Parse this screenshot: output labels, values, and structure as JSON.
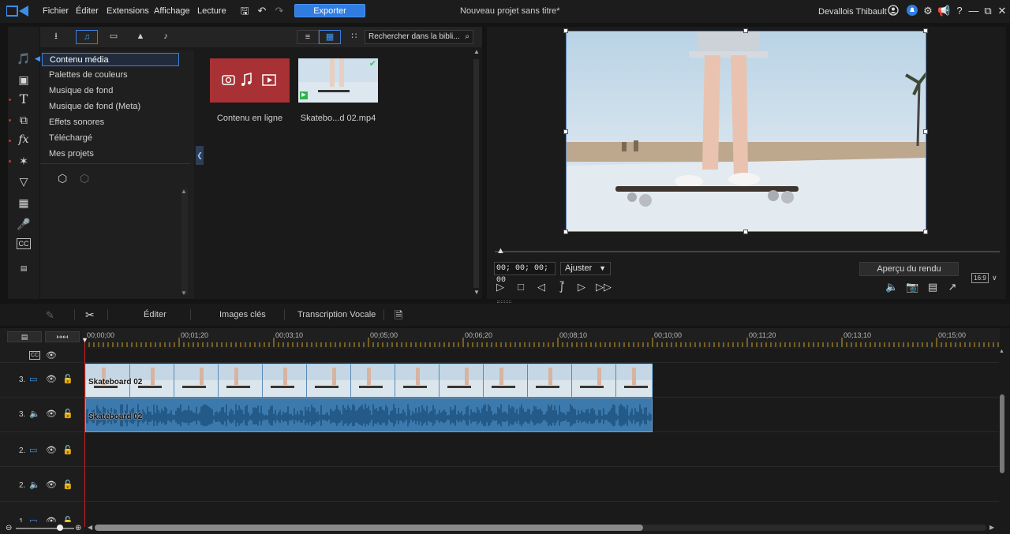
{
  "menu": {
    "items": [
      "Fichier",
      "Éditer",
      "Extensions",
      "Affichage",
      "Lecture"
    ],
    "export_label": "Exporter",
    "project_title": "Nouveau projet sans titre*",
    "user_name": "Devallois Thibault"
  },
  "library": {
    "search_placeholder": "Rechercher dans la bibli...",
    "categories": [
      "Contenu média",
      "Palettes de couleurs",
      "Musique de fond",
      "Musique de fond (Meta)",
      "Effets sonores",
      "Téléchargé",
      "Mes projets"
    ],
    "tiles": [
      {
        "label": "Contenu en ligne"
      },
      {
        "label": "Skatebo...d 02.mp4"
      }
    ]
  },
  "preview": {
    "timecode": "00; 00; 00; 00",
    "fit_option": "Ajuster",
    "render_label": "Aperçu du rendu",
    "aspect_ratio": "16:9"
  },
  "editbar": {
    "edit_label": "Éditer",
    "keyframes_label": "Images clés",
    "transcription_label": "Transcription Vocale"
  },
  "timeline": {
    "ruler_ticks": [
      "00;00;00",
      "00;01;20",
      "00;03;10",
      "00;05;00",
      "00;06;20",
      "00;08;10",
      "00;10;00",
      "00;11;20",
      "00;13;10",
      "00;15;00"
    ],
    "tracks": [
      {
        "label": "3.",
        "kind": "video"
      },
      {
        "label": "3.",
        "kind": "audio"
      },
      {
        "label": "2.",
        "kind": "video"
      },
      {
        "label": "2.",
        "kind": "audio"
      },
      {
        "label": "1.",
        "kind": "video"
      }
    ],
    "clip_video_name": "Skateboard 02",
    "clip_audio_name": "Skateboard 02",
    "cc_label": "CC"
  },
  "colors": {
    "accent": "#2f7de1",
    "online_tile": "#a73134",
    "playhead": "#d02020"
  }
}
